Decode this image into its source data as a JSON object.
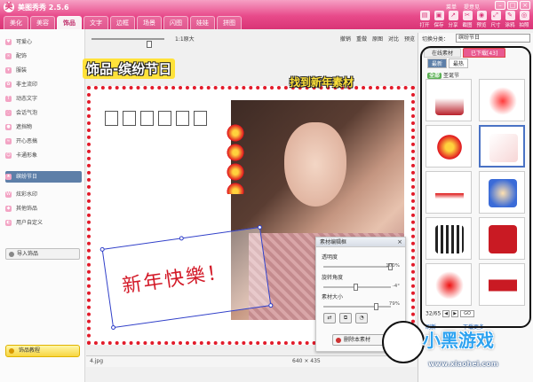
{
  "app": {
    "title": "美图秀秀 2.5.6"
  },
  "topmenu": {
    "menu": "菜单",
    "feedback": "提意见"
  },
  "tabs": [
    {
      "label": "美化"
    },
    {
      "label": "美容"
    },
    {
      "label": "饰品",
      "active": true
    },
    {
      "label": "文字"
    },
    {
      "label": "边框"
    },
    {
      "label": "场景"
    },
    {
      "label": "闪图"
    },
    {
      "label": "娃娃"
    },
    {
      "label": "拼图"
    }
  ],
  "toolbar": [
    {
      "label": "打开",
      "icon": "folder-icon"
    },
    {
      "label": "保存",
      "icon": "save-icon"
    },
    {
      "label": "分享",
      "icon": "share-icon"
    },
    {
      "label": "截图",
      "icon": "screenshot-icon"
    },
    {
      "label": "预览",
      "icon": "preview-icon"
    },
    {
      "label": "尺寸",
      "icon": "resize-icon"
    },
    {
      "label": "涂鸦",
      "icon": "pencil-icon"
    },
    {
      "label": "拍照",
      "icon": "camera-icon"
    }
  ],
  "sidebar": {
    "items": [
      {
        "label": "可爱心"
      },
      {
        "label": "配饰"
      },
      {
        "label": "服装"
      },
      {
        "label": "非主流印"
      },
      {
        "label": "动态文字"
      },
      {
        "label": "会话气泡"
      },
      {
        "label": "遮挡物"
      },
      {
        "label": "开心恶搞"
      },
      {
        "label": "卡通形象"
      },
      {
        "label": "缤纷节日",
        "selected": true
      },
      {
        "label": "炫彩水印"
      },
      {
        "label": "其他饰品"
      },
      {
        "label": "用户自定义"
      }
    ],
    "import_label": "导入饰品",
    "tutorial_label": "饰品教程"
  },
  "edit": {
    "ratio_label": "1:1原大",
    "actions": [
      "撤销",
      "重做",
      "原图",
      "对比",
      "预览"
    ]
  },
  "material_panel": {
    "title": "素材编辑框",
    "opacity_label": "透明度",
    "opacity_value": "100%",
    "opacity": 1.0,
    "rotation_label": "旋转角度",
    "rotation_value": "-4°",
    "rotation": -4,
    "size_label": "素材大小",
    "size_value": "79%",
    "size": 0.79,
    "delete_label": "删除本素材"
  },
  "status": {
    "filename": "4.jpg",
    "dimensions": "640 × 435"
  },
  "rpanel": {
    "category_label": "切换分类：",
    "category_value": "缤纷节日",
    "tab_online": "在线素材",
    "tab_downloaded": "已下载[43]",
    "sub_new": "最新",
    "sub_hot": "最热",
    "group_prefix": "全部",
    "group_name": "圣诞节",
    "page": "32/65",
    "page_go": "GO",
    "refresh": "刷新",
    "download_more": "下载更多"
  },
  "annotations": {
    "callout1": "饰品-缤纷节日",
    "callout2": "找到新年素材"
  },
  "canvas": {
    "stamp_text": "新年快樂！"
  },
  "brand": {
    "text": "小黑游戏",
    "url": "www.xiaohei.com"
  },
  "colors": {
    "accent": "#e84a8a",
    "selection": "#5d7fa8",
    "red": "#e21b2a",
    "link": "#1e5fb3"
  }
}
